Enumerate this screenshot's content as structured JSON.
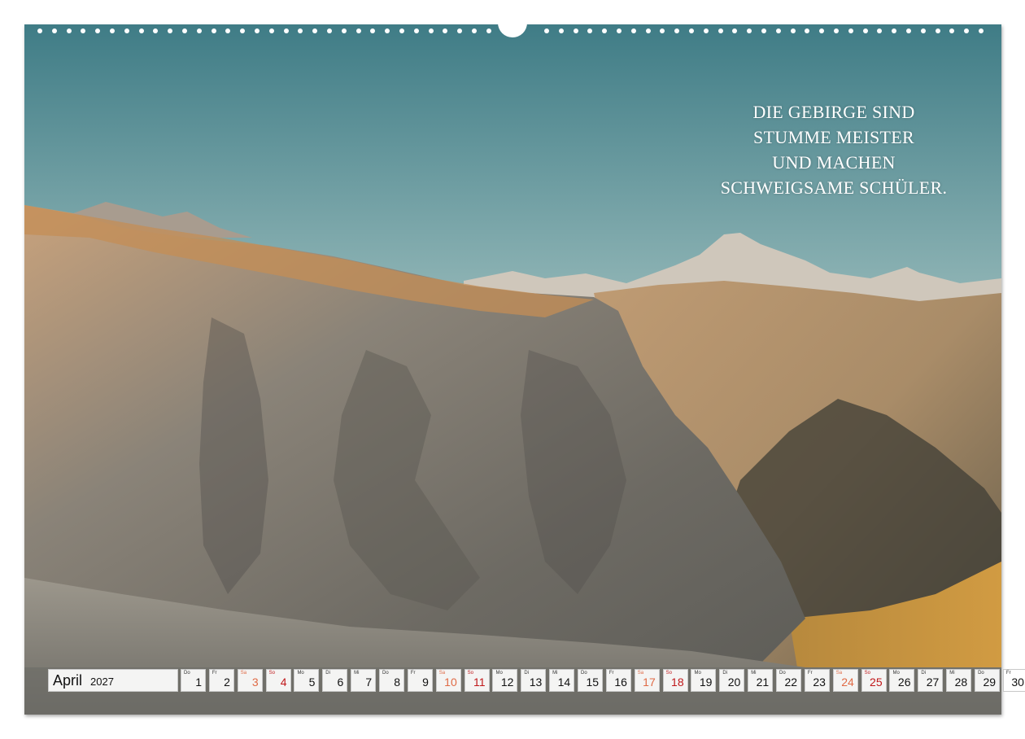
{
  "quote": {
    "lines": [
      "DIE GEBIRGE SIND",
      "STUMME MEISTER",
      "UND MACHEN",
      "SCHWEIGSAME SCHÜLER."
    ]
  },
  "calendar": {
    "month": "April",
    "year": "2027",
    "colors": {
      "saturday": "#e06a45",
      "sunday": "#c0181a"
    },
    "days": [
      {
        "wd": "Do",
        "num": "1",
        "type": "weekday"
      },
      {
        "wd": "Fr",
        "num": "2",
        "type": "weekday"
      },
      {
        "wd": "Sa",
        "num": "3",
        "type": "sat"
      },
      {
        "wd": "So",
        "num": "4",
        "type": "sun"
      },
      {
        "wd": "Mo",
        "num": "5",
        "type": "weekday"
      },
      {
        "wd": "Di",
        "num": "6",
        "type": "weekday"
      },
      {
        "wd": "Mi",
        "num": "7",
        "type": "weekday"
      },
      {
        "wd": "Do",
        "num": "8",
        "type": "weekday"
      },
      {
        "wd": "Fr",
        "num": "9",
        "type": "weekday"
      },
      {
        "wd": "Sa",
        "num": "10",
        "type": "sat"
      },
      {
        "wd": "So",
        "num": "11",
        "type": "sun"
      },
      {
        "wd": "Mo",
        "num": "12",
        "type": "weekday"
      },
      {
        "wd": "Di",
        "num": "13",
        "type": "weekday"
      },
      {
        "wd": "Mi",
        "num": "14",
        "type": "weekday"
      },
      {
        "wd": "Do",
        "num": "15",
        "type": "weekday"
      },
      {
        "wd": "Fr",
        "num": "16",
        "type": "weekday"
      },
      {
        "wd": "Sa",
        "num": "17",
        "type": "sat"
      },
      {
        "wd": "So",
        "num": "18",
        "type": "sun"
      },
      {
        "wd": "Mo",
        "num": "19",
        "type": "weekday"
      },
      {
        "wd": "Di",
        "num": "20",
        "type": "weekday"
      },
      {
        "wd": "Mi",
        "num": "21",
        "type": "weekday"
      },
      {
        "wd": "Do",
        "num": "22",
        "type": "weekday"
      },
      {
        "wd": "Fr",
        "num": "23",
        "type": "weekday"
      },
      {
        "wd": "Sa",
        "num": "24",
        "type": "sat"
      },
      {
        "wd": "So",
        "num": "25",
        "type": "sun"
      },
      {
        "wd": "Mo",
        "num": "26",
        "type": "weekday"
      },
      {
        "wd": "Di",
        "num": "27",
        "type": "weekday"
      },
      {
        "wd": "Mi",
        "num": "28",
        "type": "weekday"
      },
      {
        "wd": "Do",
        "num": "29",
        "type": "weekday"
      },
      {
        "wd": "Fr",
        "num": "30",
        "type": "weekday"
      }
    ]
  }
}
